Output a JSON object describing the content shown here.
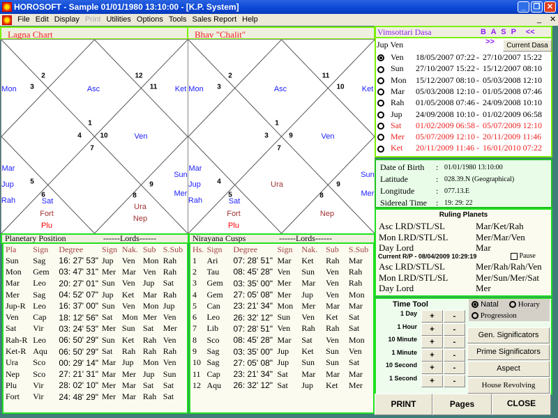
{
  "window": {
    "title": "HOROSOFT -  Sample 01/01/1980 13:10:00 - [K.P. System]"
  },
  "menu": [
    "File",
    "Edit",
    "Display",
    "Print",
    "Utilities",
    "Options",
    "Tools",
    "Sales Report",
    "Help"
  ],
  "lagna": {
    "title": "Lagna Chart",
    "houses": [
      "2",
      "3",
      "12",
      "11",
      "1",
      "4",
      "10",
      "7",
      "5",
      "6",
      "8",
      "9"
    ],
    "planets": {
      "mon": "Mon",
      "asc": "Asc",
      "ket": "Ket",
      "ven": "Ven",
      "mar": "Mar",
      "jup": "Jup",
      "rah": "Rah",
      "sat": "Sat",
      "fort": "Fort",
      "plu": "Plu",
      "ura": "Ura",
      "nep": "Nep",
      "sun": "Sun",
      "mer": "Mer"
    }
  },
  "chalit": {
    "title": "Bhav \"Chalit\"",
    "houses": [
      "2",
      "3",
      "11",
      "10",
      "1",
      "3",
      "9",
      "7",
      "4",
      "5",
      "8",
      "9"
    ],
    "planets": {
      "mon": "Mon",
      "asc": "Asc",
      "ket": "Ket",
      "ven": "Ven",
      "mar": "Mar",
      "jup": "Jup",
      "rah": "Rah",
      "sat": "Sat",
      "fort": "Fort",
      "plu": "Plu",
      "ura": "Ura",
      "nep": "Nep",
      "sun": "Sun",
      "mer": "Mer"
    }
  },
  "planetary": {
    "title": "Planetary Position",
    "lords": "------Lords------",
    "headers": [
      "Pla",
      "Sign",
      "Degree",
      "Sign",
      "Nak.",
      "Sub",
      "S.Sub"
    ],
    "rows": [
      [
        "Sun",
        "Sag",
        "16: 27' 53\"",
        "Jup",
        "Ven",
        "Mon",
        "Rah"
      ],
      [
        "Mon",
        "Gem",
        "03: 47' 31\"",
        "Mer",
        "Mar",
        "Ven",
        "Rah"
      ],
      [
        "Mar",
        "Leo",
        "20: 27' 01\"",
        "Sun",
        "Ven",
        "Jup",
        "Sat"
      ],
      [
        "Mer",
        "Sag",
        "04: 52' 07\"",
        "Jup",
        "Ket",
        "Mar",
        "Rah"
      ],
      [
        "Jup-R",
        "Leo",
        "16: 37' 00\"",
        "Sun",
        "Ven",
        "Mon",
        "Jup"
      ],
      [
        "Ven",
        "Cap",
        "18: 12' 56\"",
        "Sat",
        "Mon",
        "Mer",
        "Ven"
      ],
      [
        "Sat",
        "Vir",
        "03: 24' 53\"",
        "Mer",
        "Sun",
        "Sat",
        "Mer"
      ],
      [
        "Rah-R",
        "Leo",
        "06: 50' 29\"",
        "Sun",
        "Ket",
        "Rah",
        "Ven"
      ],
      [
        "Ket-R",
        "Aqu",
        "06: 50' 29\"",
        "Sat",
        "Rah",
        "Rah",
        "Rah"
      ],
      [
        "Ura",
        "Sco",
        "00: 29' 14\"",
        "Mar",
        "Jup",
        "Mon",
        "Ven"
      ],
      [
        "Nep",
        "Sco",
        "27: 21' 31\"",
        "Mar",
        "Mer",
        "Jup",
        "Sun"
      ],
      [
        "Plu",
        "Vir",
        "28: 02' 10\"",
        "Mer",
        "Mar",
        "Sat",
        "Sat"
      ],
      [
        "Fort",
        "Vir",
        "24: 48' 29\"",
        "Mer",
        "Mar",
        "Rah",
        "Sat"
      ]
    ]
  },
  "cusps": {
    "title": "Nirayana Cusps",
    "lords": "------Lords------",
    "headers": [
      "Hs.",
      "Sign",
      "Degree",
      "Sign",
      "Nak.",
      "Sub",
      "S.Sub"
    ],
    "rows": [
      [
        "1",
        "Ari",
        "07: 28' 51\"",
        "Mar",
        "Ket",
        "Rah",
        "Mar"
      ],
      [
        "2",
        "Tau",
        "08: 45' 28\"",
        "Ven",
        "Sun",
        "Ven",
        "Rah"
      ],
      [
        "3",
        "Gem",
        "03: 35' 00\"",
        "Mer",
        "Mar",
        "Ven",
        "Rah"
      ],
      [
        "4",
        "Gem",
        "27: 05' 08\"",
        "Mer",
        "Jup",
        "Ven",
        "Mon"
      ],
      [
        "5",
        "Can",
        "23: 21' 34\"",
        "Mon",
        "Mer",
        "Mar",
        "Mar"
      ],
      [
        "6",
        "Leo",
        "26: 32' 12\"",
        "Sun",
        "Ven",
        "Ket",
        "Sat"
      ],
      [
        "7",
        "Lib",
        "07: 28' 51\"",
        "Ven",
        "Rah",
        "Rah",
        "Sat"
      ],
      [
        "8",
        "Sco",
        "08: 45' 28\"",
        "Mar",
        "Sat",
        "Ven",
        "Mon"
      ],
      [
        "9",
        "Sag",
        "03: 35' 00\"",
        "Jup",
        "Ket",
        "Sun",
        "Ven"
      ],
      [
        "10",
        "Sag",
        "27: 05' 08\"",
        "Jup",
        "Sun",
        "Sun",
        "Sat"
      ],
      [
        "11",
        "Cap",
        "23: 21' 34\"",
        "Sat",
        "Mar",
        "Mar",
        "Mar"
      ],
      [
        "12",
        "Aqu",
        "26: 32' 12\"",
        "Sat",
        "Jup",
        "Ket",
        "Mer"
      ]
    ]
  },
  "dasa": {
    "title": "Vimsottari Dasa",
    "nav": [
      "B",
      "A",
      "S",
      "P",
      "<<",
      ">>"
    ],
    "current_label": "Jup Ven",
    "current_button": "Current Dasa",
    "rows": [
      {
        "p": "Ven",
        "from": "18/05/2007 07:22",
        "to": "27/10/2007 15:22",
        "selected": true,
        "highlight": false
      },
      {
        "p": "Sun",
        "from": "27/10/2007 15:22",
        "to": "15/12/2007 08:10",
        "selected": false,
        "highlight": false
      },
      {
        "p": "Mon",
        "from": "15/12/2007 08:10",
        "to": "05/03/2008 12:10",
        "selected": false,
        "highlight": false
      },
      {
        "p": "Mar",
        "from": "05/03/2008 12:10",
        "to": "01/05/2008 07:46",
        "selected": false,
        "highlight": false
      },
      {
        "p": "Rah",
        "from": "01/05/2008 07:46",
        "to": "24/09/2008 10:10",
        "selected": false,
        "highlight": false
      },
      {
        "p": "Jup",
        "from": "24/09/2008 10:10",
        "to": "01/02/2009 06:58",
        "selected": false,
        "highlight": false
      },
      {
        "p": "Sat",
        "from": "01/02/2009 06:58",
        "to": "05/07/2009 12:10",
        "selected": false,
        "highlight": true
      },
      {
        "p": "Mer",
        "from": "05/07/2009 12:10",
        "to": "20/11/2009 11:46",
        "selected": false,
        "highlight": true
      },
      {
        "p": "Ket",
        "from": "20/11/2009 11:46",
        "to": "16/01/2010 07:22",
        "selected": false,
        "highlight": true
      }
    ],
    "sep": "-"
  },
  "birth": [
    {
      "label": "Date of Birth",
      "value": "01/01/1980 13:10:00"
    },
    {
      "label": "Latitude",
      "value": "028.39.N (Geographical)"
    },
    {
      "label": "Longitude",
      "value": "077.13.E"
    },
    {
      "label": "Sidereal Time",
      "value": " 19: 29: 22"
    }
  ],
  "ruling": {
    "title": "Ruling Planets",
    "natal": [
      [
        "Asc LRD/STL/SL",
        "Mar/Ket/Rah"
      ],
      [
        "Mon LRD/STL/SL",
        "Mer/Mar/Ven"
      ],
      [
        "Day Lord",
        "Mar"
      ]
    ],
    "current_title": "Current R/P - 08/04/2009 10:29:19",
    "pause": "Pause",
    "current": [
      [
        "Asc LRD/STL/SL",
        "Mer/Rah/Rah/Ven"
      ],
      [
        "Mon LRD/STL/SL",
        "Mer/Sun/Mer/Sat"
      ],
      [
        "Day Lord",
        "Mer"
      ]
    ]
  },
  "timetool": {
    "title": "Time Tool",
    "steps": [
      "1 Day",
      "1 Hour",
      "10 Minute",
      "1 Minute",
      "10 Second",
      "1 Second"
    ],
    "plus": "+",
    "minus": "-"
  },
  "mode": {
    "natal": "Natal",
    "horary": "Horary",
    "progression": "Progression",
    "selected": "Natal"
  },
  "actions": [
    "Gen. Significators",
    "Prime Significators",
    "Aspect",
    "House Revolving"
  ],
  "bottom": {
    "print": "PRINT",
    "pages": "Pages",
    "close": "CLOSE"
  },
  "colors": {
    "titlebar": "#0a46d6",
    "planet_blue": "#2020ff",
    "planet_brown": "#a03030",
    "highlight": "#f02020",
    "panel_border": "#20e020"
  }
}
